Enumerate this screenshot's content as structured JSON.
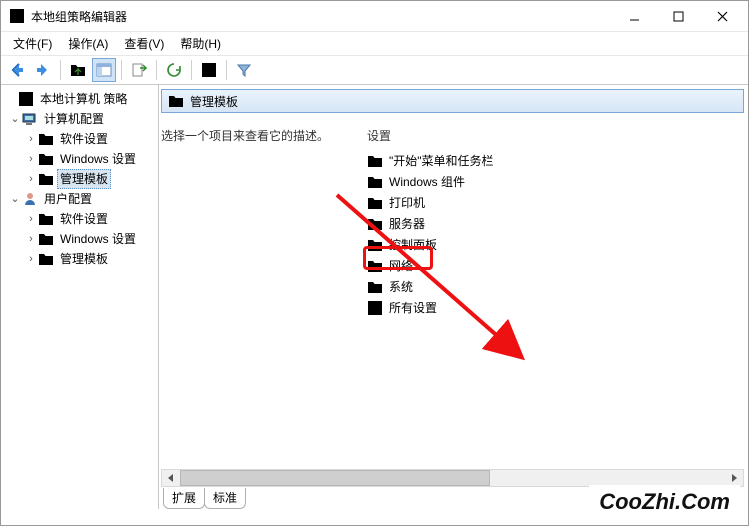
{
  "window": {
    "title": "本地组策略编辑器"
  },
  "menu": {
    "file": "文件(F)",
    "action": "操作(A)",
    "view": "查看(V)",
    "help": "帮助(H)"
  },
  "tree": {
    "root": "本地计算机 策略",
    "computer": "计算机配置",
    "software1": "软件设置",
    "windows1": "Windows 设置",
    "admin1": "管理模板",
    "user": "用户配置",
    "software2": "软件设置",
    "windows2": "Windows 设置",
    "admin2": "管理模板"
  },
  "crumb": {
    "label": "管理模板"
  },
  "desc": {
    "hint": "选择一个项目来查看它的描述。"
  },
  "list": {
    "header": "设置",
    "items": {
      "start": "\"开始\"菜单和任务栏",
      "wincomp": "Windows 组件",
      "printer": "打印机",
      "server": "服务器",
      "control": "控制面板",
      "network": "网络",
      "system": "系统",
      "all": "所有设置"
    }
  },
  "tabs": {
    "extended": "扩展",
    "standard": "标准"
  },
  "watermark": "CooZhi.Com",
  "colors": {
    "highlight": "#e11",
    "selection": "#d8e6f2"
  }
}
